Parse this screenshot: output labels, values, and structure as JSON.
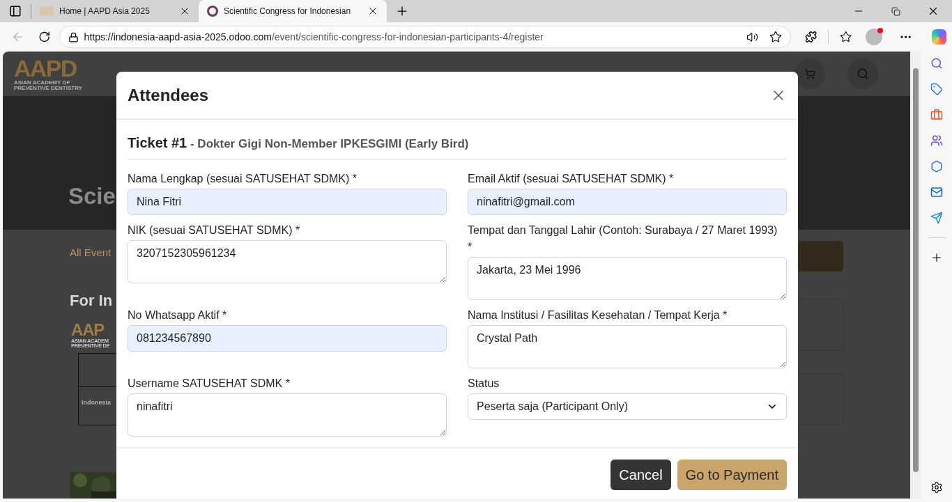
{
  "browser": {
    "tabs": [
      {
        "title": "Home | AAPD Asia 2025",
        "selected": false
      },
      {
        "title": "Scientific Congress for Indonesian",
        "selected": true
      }
    ],
    "url": {
      "host": "https://indonesia-aapd-asia-2025.odoo.com",
      "path": "/event/scientific-congress-for-indonesian-participants-4/register"
    }
  },
  "page": {
    "logo": {
      "mark": "AAPD",
      "subtitle": "ASIAN ACADEMY OF PREVENTIVE DENTISTRY"
    },
    "hero_title": "Scie",
    "breadcrumb": "All Event",
    "heading": "For In",
    "poster": {
      "mark": "AAP",
      "line_1": "ASIAN ACADEM",
      "line_2": "PREVENTIVE DE",
      "cell": "Indonesia"
    }
  },
  "modal": {
    "title": "Attendees",
    "ticket_label": "Ticket #1",
    "ticket_name": " - Dokter Gigi Non-Member IPKESGIMI (Early Bird)",
    "fields": [
      {
        "label": "Nama Lengkap (sesuai SATUSEHAT SDMK) *",
        "value": "Nina Fitri",
        "kind": "input",
        "autofilled": true
      },
      {
        "label": "Email Aktif (sesuai SATUSEHAT SDMK) *",
        "value": "ninafitri@gmail.com",
        "kind": "input",
        "autofilled": true
      },
      {
        "label": "NIK (sesuai SATUSEHAT SDMK) *",
        "value": "3207152305961234",
        "kind": "textarea",
        "autofilled": false
      },
      {
        "label": "Tempat dan Tanggal Lahir (Contoh: Surabaya / 27 Maret 1993)\n*",
        "value": "Jakarta, 23 Mei 1996",
        "kind": "textarea",
        "autofilled": false
      },
      {
        "label": "No Whatsapp Aktif *",
        "value": "081234567890",
        "kind": "input",
        "autofilled": true
      },
      {
        "label": "Nama Institusi / Fasilitas Kesehatan / Tempat Kerja *",
        "value": "Crystal Path",
        "kind": "textarea",
        "autofilled": false
      },
      {
        "label": "Username SATUSEHAT SDMK *",
        "value": "ninafitri",
        "kind": "textarea",
        "autofilled": false
      },
      {
        "label": "Status",
        "value": "Peserta saja (Participant Only)",
        "kind": "select",
        "autofilled": false
      }
    ],
    "buttons": [
      {
        "label": "Cancel",
        "kind": "secondary"
      },
      {
        "label": "Go to Payment",
        "kind": "primary"
      }
    ]
  }
}
